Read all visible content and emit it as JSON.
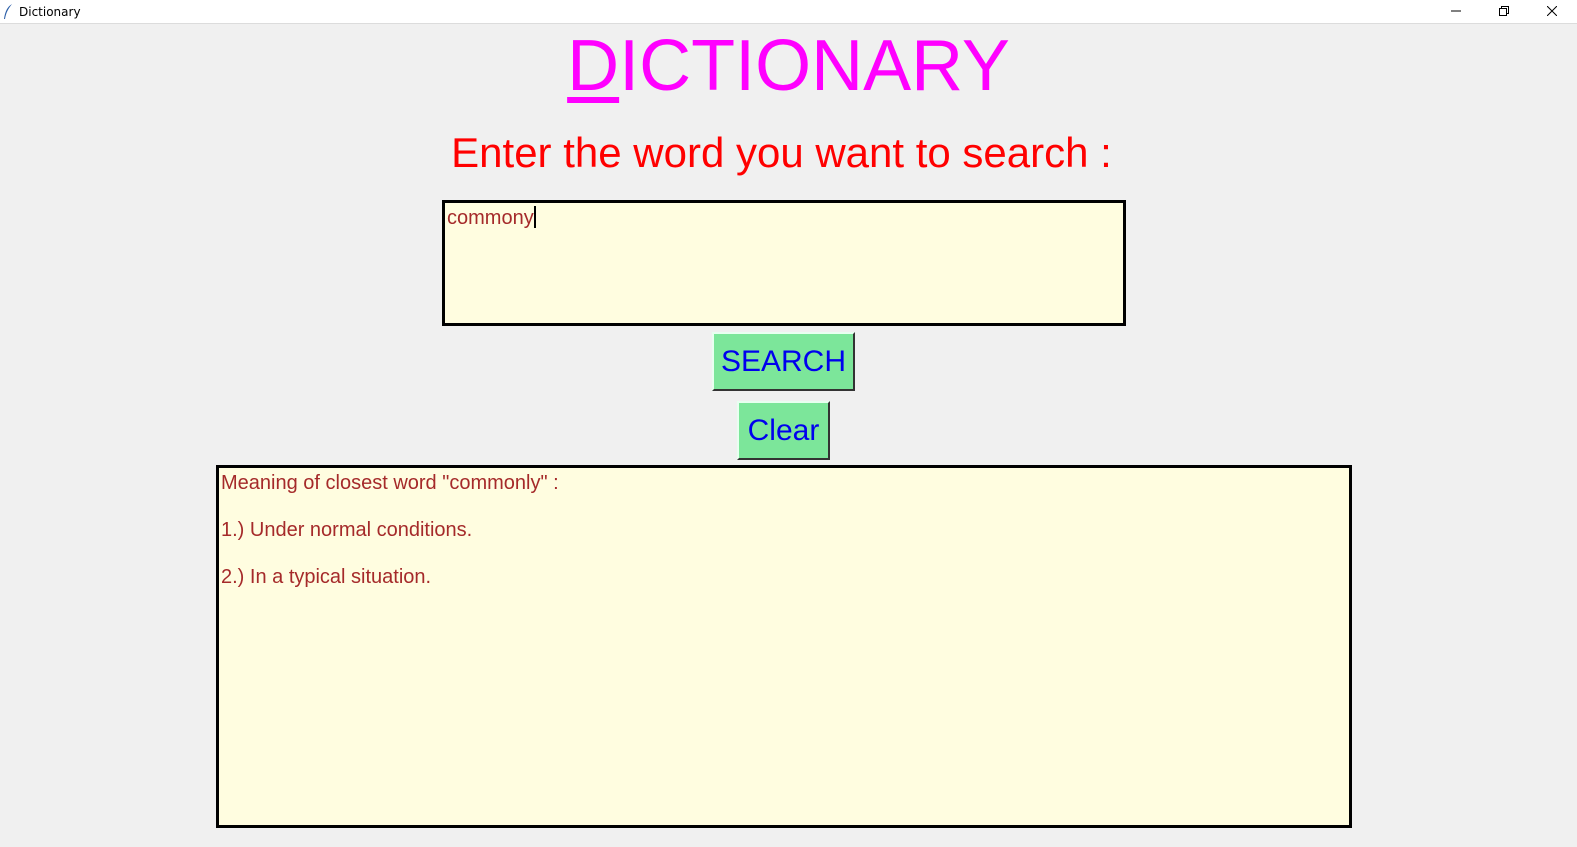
{
  "window": {
    "title": "Dictionary"
  },
  "heading": {
    "first_letter": "D",
    "rest": "ICTIONARY",
    "color": "#ff00ff"
  },
  "prompt": {
    "text": "Enter the word you want to search :",
    "color": "#ff0000"
  },
  "search_input": {
    "value": "commony"
  },
  "buttons": {
    "search_label": "SEARCH",
    "clear_label": "Clear",
    "bg_color": "#7ce69a",
    "text_color": "#0000ee"
  },
  "result": {
    "lines": [
      "Meaning of closest word \"commonly\" :",
      "1.) Under normal conditions.",
      "2.) In a typical situation."
    ],
    "text_color": "#a52a2a",
    "bg_color": "#fffde0"
  },
  "icons": {
    "app": "feather-icon",
    "minimize": "minimize-icon",
    "maximize": "restore-icon",
    "close": "close-icon"
  }
}
